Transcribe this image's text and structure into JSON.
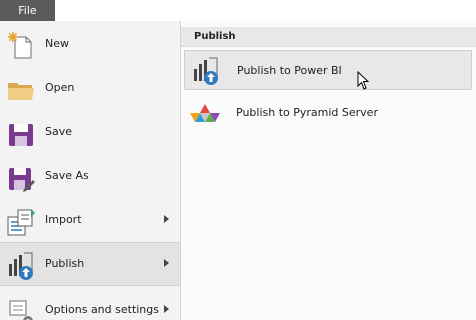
{
  "titlebar": {
    "file_tab": "File"
  },
  "menu": {
    "items": [
      {
        "label": "New",
        "icon": "new-document-icon"
      },
      {
        "label": "Open",
        "icon": "folder-icon"
      },
      {
        "label": "Save",
        "icon": "save-disk-icon"
      },
      {
        "label": "Save As",
        "icon": "save-as-icon"
      },
      {
        "label": "Import",
        "icon": "import-icon",
        "has_submenu": true
      },
      {
        "label": "Publish",
        "icon": "publish-powerbi-icon",
        "has_submenu": true,
        "selected": true
      },
      {
        "label": "Options and settings",
        "icon": "settings-gear-icon",
        "has_submenu": true
      }
    ]
  },
  "publish_panel": {
    "header": "Publish",
    "items": [
      {
        "label": "Publish to Power BI",
        "icon": "powerbi-upload-icon",
        "hovered": true
      },
      {
        "label": "Publish to Pyramid Server",
        "icon": "pyramid-icon"
      }
    ]
  },
  "colors": {
    "file_tab": "#5b5b5b",
    "save_purple": "#7a3b8f",
    "powerbi_blue": "#2f7bbf",
    "folder": "#e8c170"
  }
}
